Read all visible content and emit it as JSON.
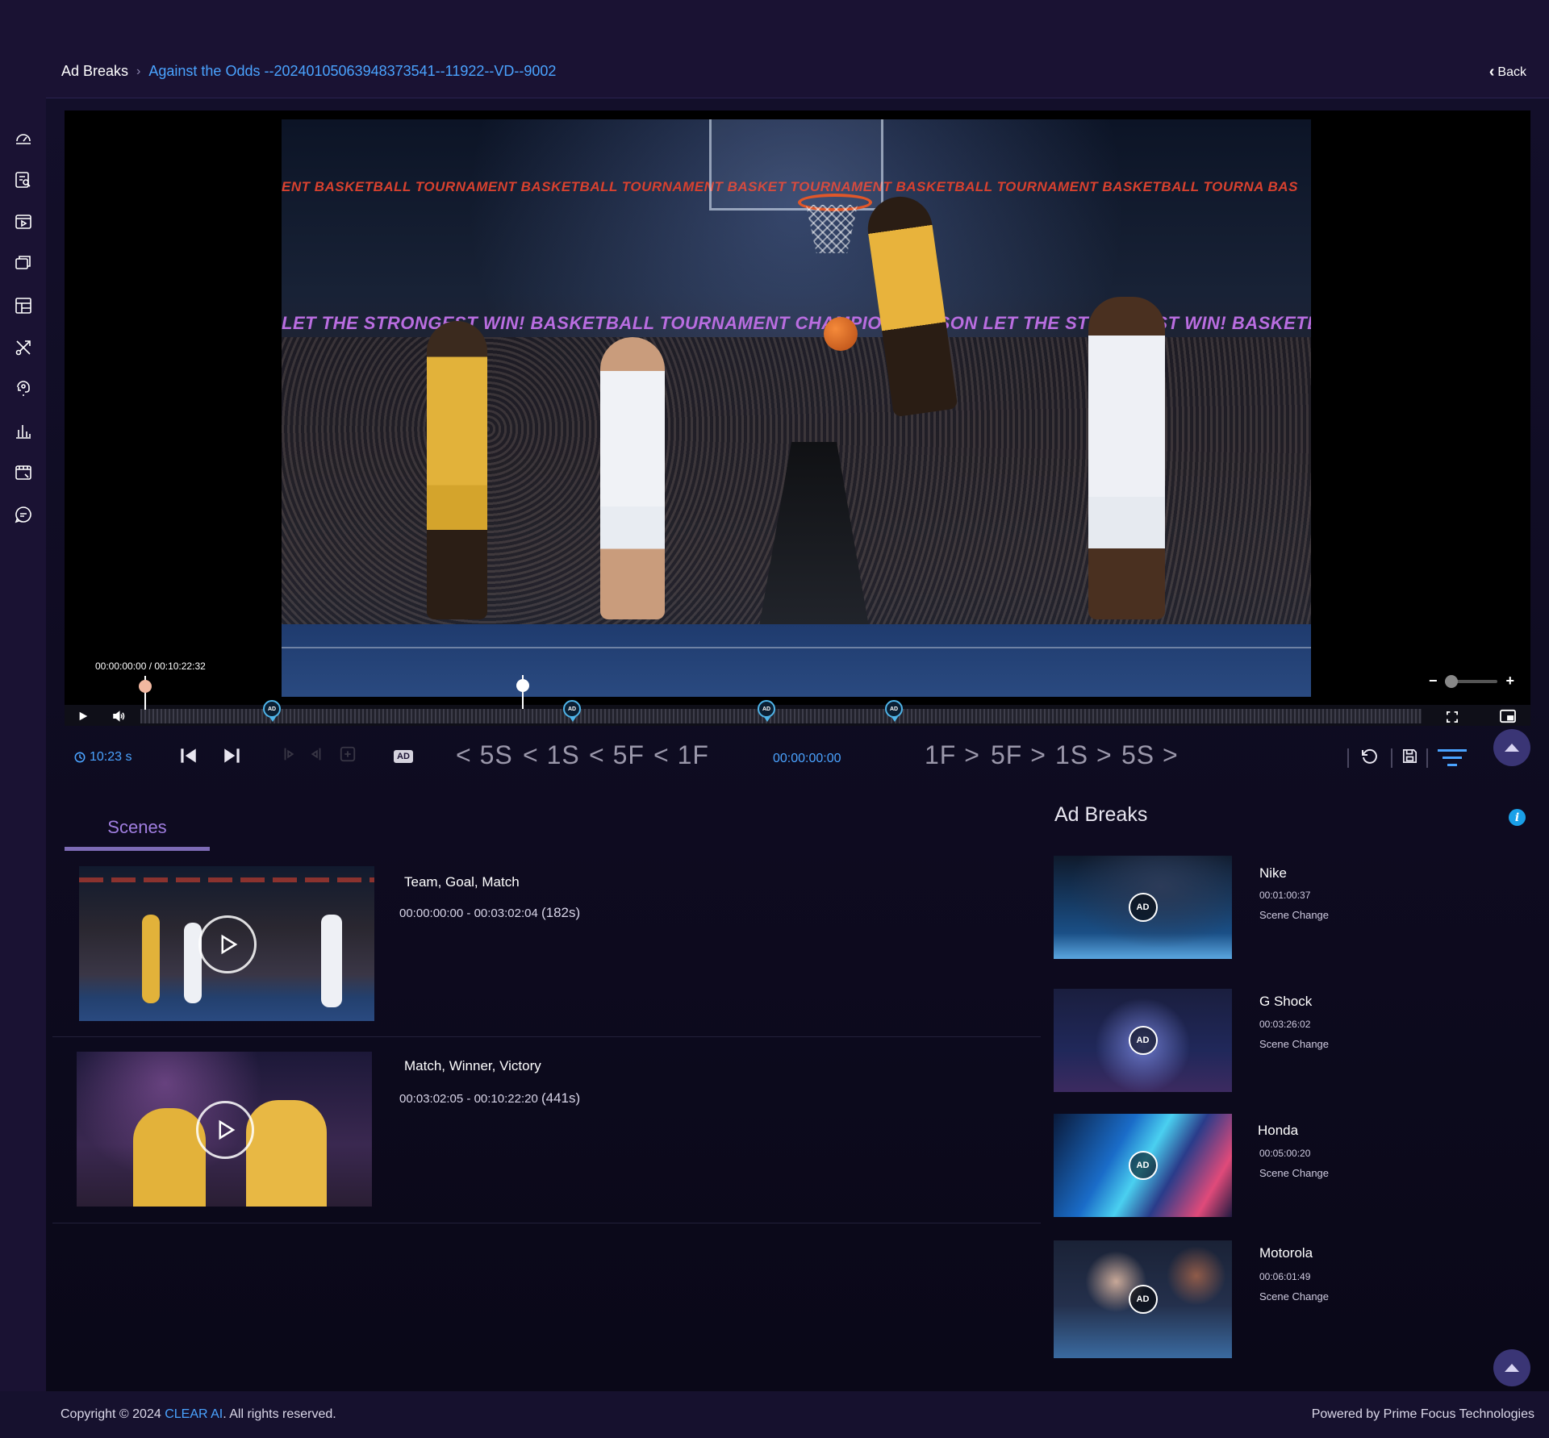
{
  "breadcrumb": {
    "root": "Ad Breaks",
    "current": "Against the Odds --20240105063948373541--11922--VD--9002"
  },
  "back_label": "Back",
  "sidebar": {
    "items": [
      {
        "icon": "dashboard-gauge-icon"
      },
      {
        "icon": "search-list-icon"
      },
      {
        "icon": "video-player-icon"
      },
      {
        "icon": "media-library-icon"
      },
      {
        "icon": "layout-grid-icon"
      },
      {
        "icon": "tools-icon"
      },
      {
        "icon": "ai-assist-icon"
      },
      {
        "icon": "analytics-bar-icon"
      },
      {
        "icon": "video-clip-icon"
      },
      {
        "icon": "chat-bubble-icon"
      }
    ]
  },
  "video": {
    "banner_top": "ENT   BASKETBALL TOURNAMENT   BASKETBALL TOURNAMENT   BASKET   TOURNAMENT   BASKETBALL TOURNAMENT   BASKETBALL TOURNA   BAS",
    "banner_mid": "LET THE STRONGEST WIN!   BASKETBALL TOURNAMENT   CHAMPION SEASON   LET THE STRONGEST WIN!   BASKETBALL TOURNAMENT"
  },
  "player": {
    "time_readout": "00:00:00:00 / 00:10:22:32",
    "ad_marker_label": "AD",
    "zoom_minus": "−",
    "zoom_plus": "+"
  },
  "toolbar": {
    "duration": "10:23 s",
    "ad_toggle_label": "AD",
    "back_5s": "< 5S",
    "back_1s": "< 1S",
    "back_5f": "< 5F",
    "back_1f": "< 1F",
    "timecode": "00:00:00:00",
    "fwd_1f": "1F >",
    "fwd_5f": "5F >",
    "fwd_1s": "1S >",
    "fwd_5s": "5S >"
  },
  "tabs": {
    "scenes": "Scenes"
  },
  "scenes": [
    {
      "tags": "Team, Goal, Match",
      "range": "00:00:00:00 - 00:03:02:04",
      "duration": "(182s)"
    },
    {
      "tags": "Match, Winner, Victory",
      "range": "00:03:02:05 - 00:10:22:20",
      "duration": "(441s)"
    }
  ],
  "ad_breaks": {
    "title": "Ad Breaks",
    "info_label": "i",
    "badge_label": "AD",
    "items": [
      {
        "name": "Nike",
        "timecode": "00:01:00:37",
        "type": "Scene Change"
      },
      {
        "name": "G Shock",
        "timecode": "00:03:26:02",
        "type": "Scene Change"
      },
      {
        "name": "Honda",
        "timecode": "00:05:00:20",
        "type": "Scene Change"
      },
      {
        "name": "Motorola",
        "timecode": "00:06:01:49",
        "type": "Scene Change"
      }
    ]
  },
  "footer": {
    "copyright_prefix": "Copyright © 2024 ",
    "brand": "CLEAR AI",
    "copyright_suffix": ". All rights reserved.",
    "powered_by": "Powered by Prime Focus Technologies"
  },
  "colors": {
    "accent": "#4aa3ff",
    "tab_active": "#a07ee0",
    "sidebar_bg": "#1a1233",
    "ad_marker": "#4fb4e8"
  }
}
